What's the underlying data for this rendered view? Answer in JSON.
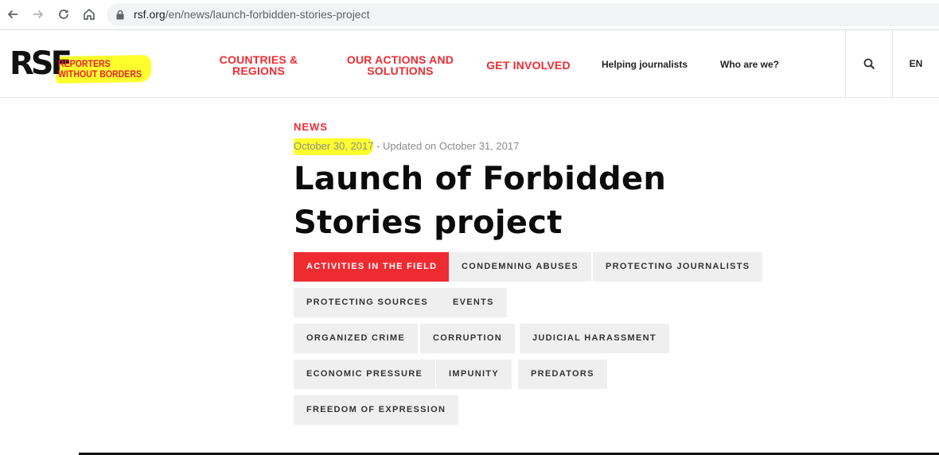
{
  "browser": {
    "url_host": "rsf.org",
    "url_path": "/en/news/launch-forbidden-stories-project"
  },
  "header": {
    "logo": {
      "mark": "RSF",
      "line1": "REPORTERS",
      "line2": "WITHOUT BORDERS"
    },
    "menu": [
      {
        "line1": "COUNTRIES &",
        "line2": "REGIONS"
      },
      {
        "line1": "OUR ACTIONS AND",
        "line2": "SOLUTIONS"
      },
      {
        "line1": "GET INVOLVED",
        "line2": ""
      }
    ],
    "links": [
      "Helping journalists",
      "Who are we?"
    ],
    "language": "EN"
  },
  "article": {
    "kicker": "NEWS",
    "date": "October 30, 2017",
    "updated": " - Updated on October 31, 2017",
    "title": "Launch of Forbidden Stories project",
    "tags": [
      {
        "label": "ACTIVITIES IN THE FIELD",
        "active": true
      },
      {
        "label": "CONDEMNING ABUSES",
        "active": false
      },
      {
        "label": "PROTECTING JOURNALISTS",
        "active": false
      },
      {
        "label": "PROTECTING SOURCES",
        "active": false
      },
      {
        "label": "EVENTS",
        "active": false
      },
      {
        "label": "ORGANIZED CRIME",
        "active": false
      },
      {
        "label": "CORRUPTION",
        "active": false
      },
      {
        "label": "JUDICIAL HARASSMENT",
        "active": false
      },
      {
        "label": "ECONOMIC PRESSURE",
        "active": false
      },
      {
        "label": "IMPUNITY",
        "active": false
      },
      {
        "label": "PREDATORS",
        "active": false
      },
      {
        "label": "FREEDOM OF EXPRESSION",
        "active": false
      }
    ]
  },
  "colors": {
    "brand_red": "#ef2b32",
    "highlight_yellow": "#ffff2e",
    "tag_bg": "#efefef"
  },
  "icons": [
    "back-arrow-icon",
    "forward-arrow-icon",
    "reload-icon",
    "home-icon",
    "lock-icon",
    "search-icon"
  ]
}
